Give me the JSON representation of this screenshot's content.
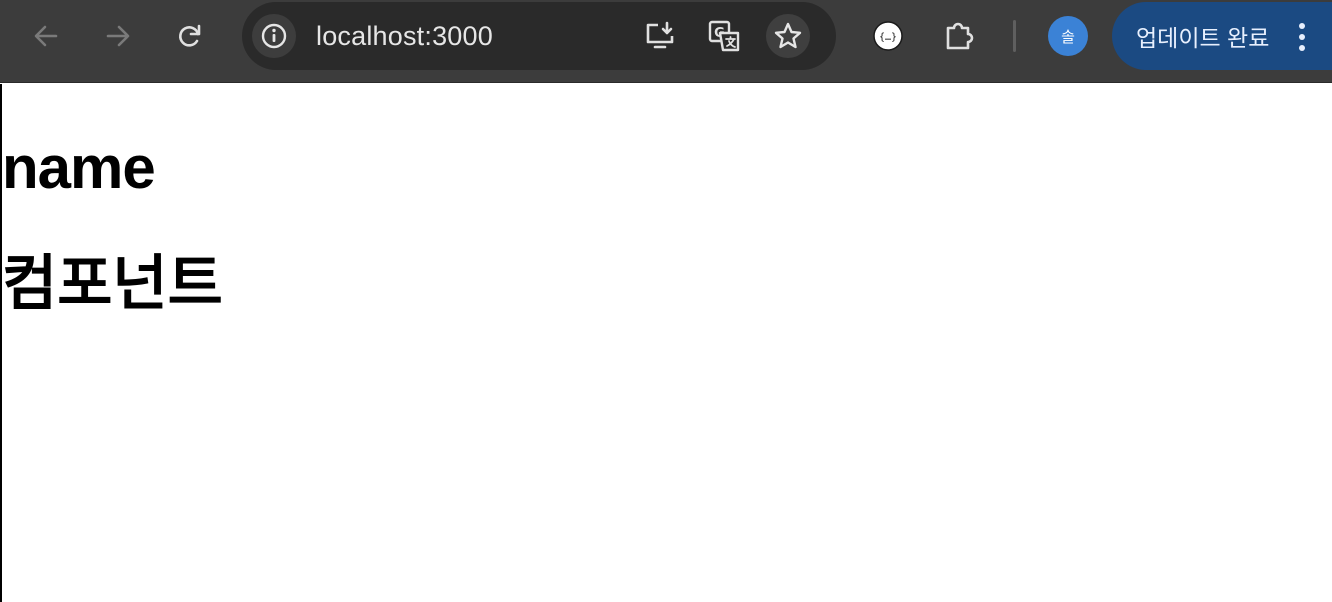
{
  "browser": {
    "address": "localhost:3000",
    "profile_initial": "솔",
    "update_label": "업데이트 완료",
    "colors": {
      "toolbar": "#3c3c3c",
      "omnibox": "#2a2a2a",
      "avatar": "#3b82d6",
      "update_button": "#1b4a82"
    },
    "icons": {
      "back": "arrow-left-icon",
      "forward": "arrow-right-icon",
      "reload": "reload-icon",
      "site_info": "info-icon",
      "install": "install-app-icon",
      "translate": "translate-icon",
      "bookmark": "star-icon",
      "json_viewer": "json-extension-icon",
      "extensions": "puzzle-icon",
      "menu": "three-dots-vertical-icon"
    }
  },
  "page": {
    "heading_1": "name",
    "heading_2": "컴포넌트"
  }
}
